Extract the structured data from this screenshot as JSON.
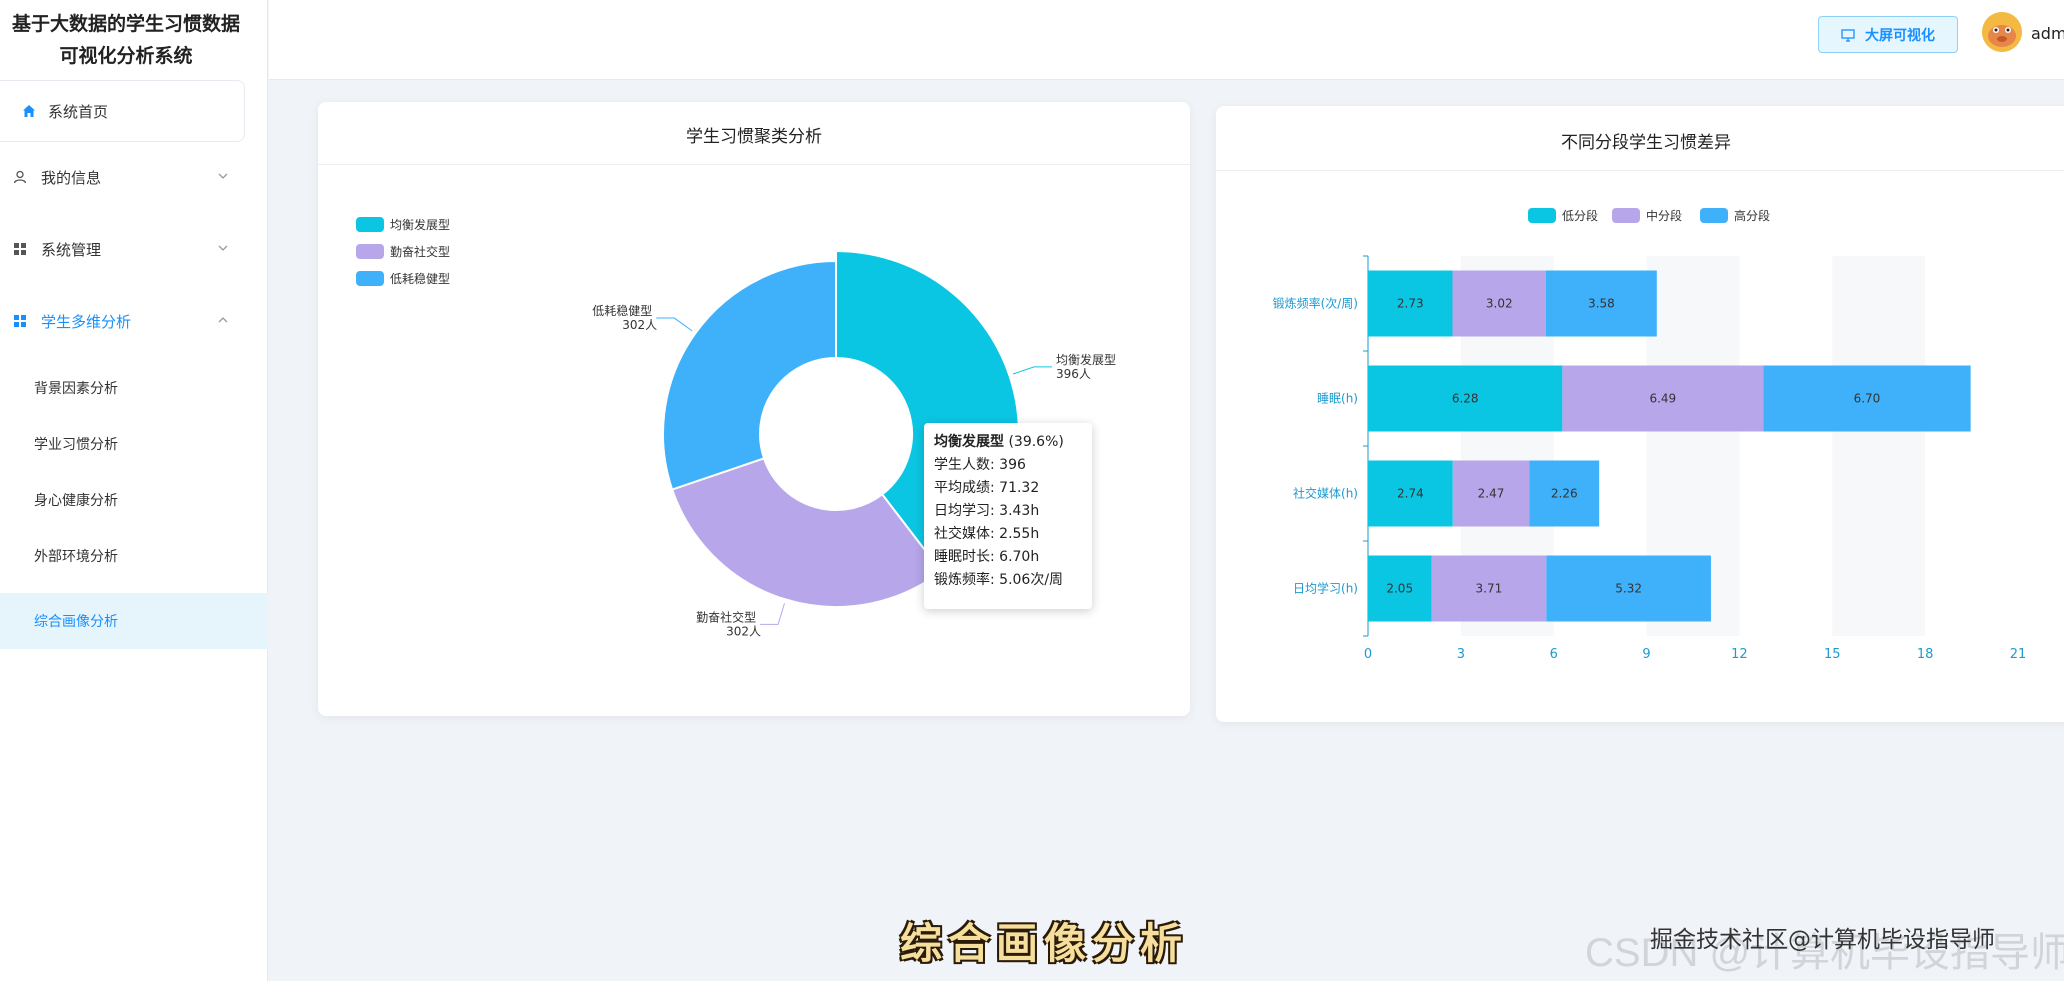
{
  "sidebar": {
    "title_line1": "基于大数据的学生习惯数据",
    "title_line2": "可视化分析系统",
    "home": "系统首页",
    "items": [
      {
        "label": "我的信息"
      },
      {
        "label": "系统管理"
      },
      {
        "label": "学生多维分析"
      }
    ],
    "sub_items": [
      {
        "label": "背景因素分析"
      },
      {
        "label": "学业习惯分析"
      },
      {
        "label": "身心健康分析"
      },
      {
        "label": "外部环境分析"
      },
      {
        "label": "综合画像分析"
      }
    ]
  },
  "header": {
    "bigscreen_label": "大屏可视化",
    "username": "adm"
  },
  "cluster_card": {
    "title": "学生习惯聚类分析"
  },
  "diff_card": {
    "title": "不同分段学生习惯差异"
  },
  "tooltip": {
    "name": "均衡发展型",
    "pct": " (39.6%)",
    "lines": [
      "学生人数: 396",
      "平均成绩: 71.32",
      "日均学习: 3.43h",
      "社交媒体: 2.55h",
      "睡眠时长: 6.70h",
      "锻炼频率: 5.06次/周"
    ]
  },
  "colors": {
    "teal": "#0bc6e3",
    "purple": "#b7a6ea",
    "blue": "#3fb1fb",
    "accent": "#1890ff"
  },
  "chart_data": [
    {
      "type": "pie",
      "title": "学生习惯聚类分析",
      "legend_position": "top-left",
      "slices": [
        {
          "name": "均衡发展型",
          "value": 396,
          "label_count": "396人",
          "color": "#0bc6e3"
        },
        {
          "name": "勤奋社交型",
          "value": 302,
          "label_count": "302人",
          "color": "#b7a6ea"
        },
        {
          "name": "低耗稳健型",
          "value": 302,
          "label_count": "302人",
          "color": "#3fb1fb"
        }
      ]
    },
    {
      "type": "bar",
      "orientation": "horizontal",
      "stacked": true,
      "title": "不同分段学生习惯差异",
      "legend_position": "top-center",
      "categories": [
        "锻炼频率(次/周)",
        "睡眠(h)",
        "社交媒体(h)",
        "日均学习(h)"
      ],
      "series": [
        {
          "name": "低分段",
          "color": "#0bc6e3",
          "values": [
            2.73,
            6.28,
            2.74,
            2.05
          ],
          "labels": [
            "2.73",
            "6.28",
            "2.74",
            "2.05"
          ]
        },
        {
          "name": "中分段",
          "color": "#b7a6ea",
          "values": [
            3.02,
            6.49,
            2.47,
            3.71
          ],
          "labels": [
            "3.02",
            "6.49",
            "2.47",
            "3.71"
          ]
        },
        {
          "name": "高分段",
          "color": "#3fb1fb",
          "values": [
            3.58,
            6.7,
            2.26,
            5.32
          ],
          "labels": [
            "3.58",
            "6.70",
            "2.26",
            "5.32"
          ]
        }
      ],
      "xlim": [
        0,
        21
      ],
      "xticks": [
        "0",
        "3",
        "6",
        "9",
        "12",
        "15",
        "18",
        "21"
      ]
    }
  ],
  "overlay": {
    "caption": "综合画像分析",
    "watermark": "掘金技术社区@计算机毕设指导师",
    "watermark_ghost": "CSDN @计算机毕设指导师"
  }
}
